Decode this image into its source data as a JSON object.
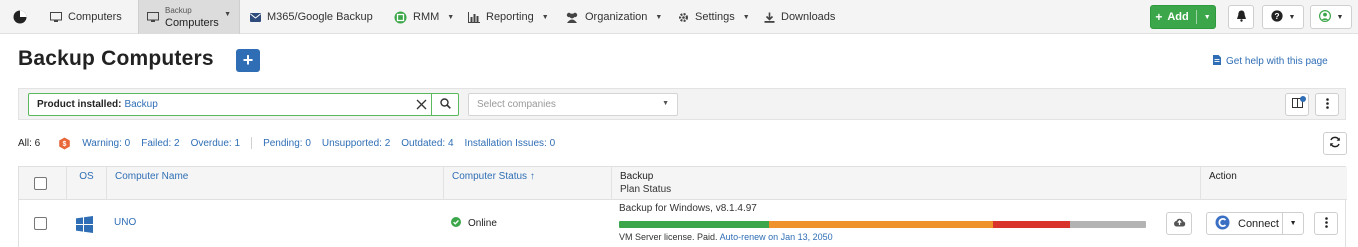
{
  "nav": {
    "items": [
      {
        "label": "Computers",
        "icon": "monitor-icon"
      },
      {
        "label_small": "Backup",
        "label": "Computers",
        "icon": "monitor-icon",
        "active": true,
        "has_caret": true
      },
      {
        "label": "M365/Google Backup",
        "icon": "envelope-icon"
      },
      {
        "label": "RMM",
        "icon": "rmm-icon",
        "has_caret": true
      },
      {
        "label": "Reporting",
        "icon": "bar-chart-icon",
        "has_caret": true
      },
      {
        "label": "Organization",
        "icon": "users-icon",
        "has_caret": true
      },
      {
        "label": "Settings",
        "icon": "gear-icon",
        "has_caret": true
      },
      {
        "label": "Downloads",
        "icon": "download-icon"
      }
    ],
    "add_label": "Add"
  },
  "header": {
    "title": "Backup Computers",
    "help_label": "Get help with this page"
  },
  "filter": {
    "key": "Product installed:",
    "value": "Backup",
    "companies_placeholder": "Select companies"
  },
  "counts": {
    "all": "All: 6",
    "warning": "Warning: 0",
    "failed": "Failed: 2",
    "overdue": "Overdue: 1",
    "pending": "Pending: 0",
    "unsupported": "Unsupported: 2",
    "outdated": "Outdated: 4",
    "installation_issues": "Installation Issues: 0"
  },
  "table": {
    "columns": {
      "os": "OS",
      "computer_name": "Computer Name",
      "computer_status": "Computer Status ↑",
      "backup": "Backup",
      "plan_status": "Plan Status",
      "action": "Action"
    },
    "rows": [
      {
        "os_icon": "windows-icon",
        "name": "UNO",
        "status": "Online",
        "plan_title": "Backup for Windows, v8.1.4.97",
        "license": "VM Server license. Paid.",
        "renew": "Auto-renew on Jan 13, 2050",
        "plan_bar": [
          {
            "status": "success",
            "fraction": 0.285,
            "color": "#3ca74a"
          },
          {
            "status": "warning",
            "fraction": 0.425,
            "color": "#f0922b"
          },
          {
            "status": "failed",
            "fraction": 0.145,
            "color": "#d9342b"
          },
          {
            "status": "none",
            "fraction": 0.145,
            "color": "#b3b3b3"
          }
        ],
        "connect_label": "Connect"
      }
    ]
  },
  "colors": {
    "accent": "#2f6eb5",
    "add_button": "#3ca74a",
    "online": "#3ca74a",
    "warning_badge": "#e8683a"
  }
}
